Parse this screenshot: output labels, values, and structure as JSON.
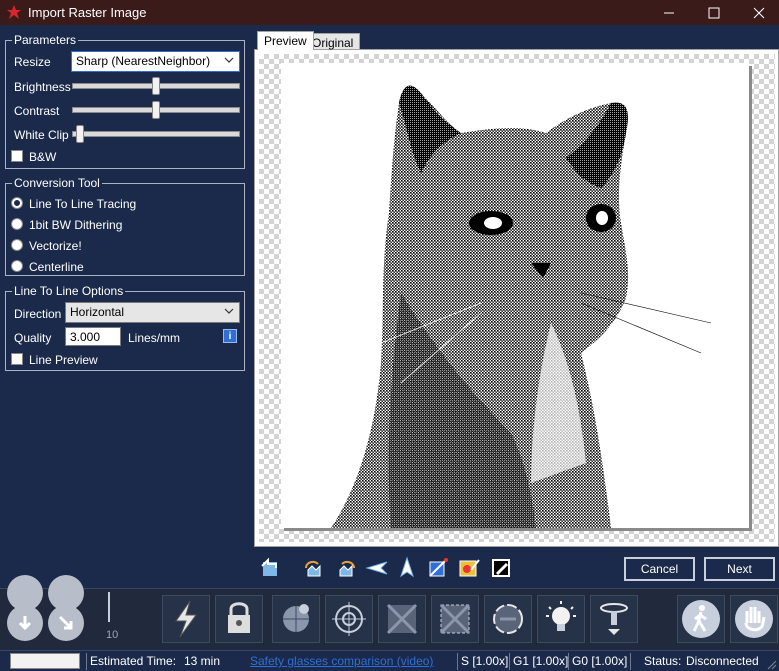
{
  "window": {
    "title": "Import Raster Image",
    "minimize": "—",
    "maximize": "☐",
    "close": "✕"
  },
  "parameters": {
    "title": "Parameters",
    "resize_label": "Resize",
    "resize_value": "Sharp (NearestNeighbor)",
    "brightness_label": "Brightness",
    "brightness_level": 0.5,
    "contrast_label": "Contrast",
    "contrast_level": 0.5,
    "white_clip_label": "White Clip",
    "white_clip_level": 0.0,
    "bw_label": "B&W",
    "bw_checked": false
  },
  "conversion": {
    "title": "Conversion Tool",
    "options": [
      "Line To Line Tracing",
      "1bit BW Dithering",
      "Vectorize!",
      "Centerline"
    ],
    "selected": 0
  },
  "line_options": {
    "title": "Line To Line Options",
    "direction_label": "Direction",
    "direction_value": "Horizontal",
    "quality_label": "Quality",
    "quality_value": "3.000",
    "quality_unit": "Lines/mm",
    "info_icon": "i",
    "line_preview_label": "Line Preview",
    "line_preview_checked": false
  },
  "tabs": {
    "preview": "Preview",
    "original": "Original"
  },
  "toolbar_icons": [
    "reset-icon",
    "rotate-left-icon",
    "rotate-right-icon",
    "flip-horizontal-icon",
    "flip-vertical-icon",
    "crop-icon",
    "color-icon",
    "invert-icon"
  ],
  "buttons": {
    "cancel": "Cancel",
    "next": "Next"
  },
  "bottom_tools": [
    "fire-icon",
    "lock-icon",
    "globe-icon",
    "target-icon",
    "frame-icon",
    "frame-dashed-icon",
    "rotary-icon",
    "light-bulb-icon",
    "focus-icon"
  ],
  "jog_scale": "10",
  "status": {
    "estimated_label": "Estimated Time:",
    "estimated_value": "13 min",
    "link": "Safety glasses comparison (video)",
    "s": "S [1.00x]",
    "g1": "G1 [1.00x]",
    "g0": "G0 [1.00x]",
    "status_label": "Status:",
    "status_value": "Disconnected"
  },
  "colors": {
    "background": "#1b2a4a",
    "titlebar": "#3b1a1a",
    "accent": "#2f6fd6"
  }
}
